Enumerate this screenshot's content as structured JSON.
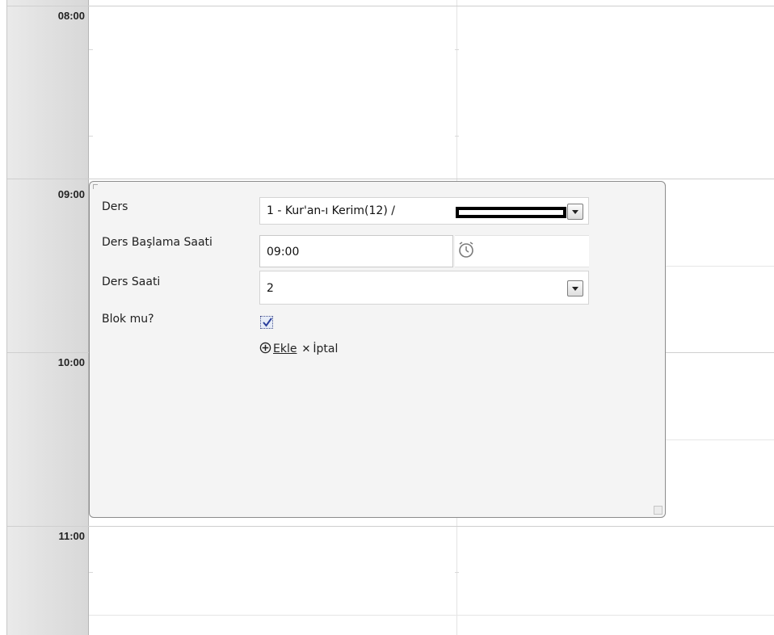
{
  "timeline": {
    "hours": [
      "08:00",
      "09:00",
      "10:00",
      "11:00"
    ]
  },
  "form": {
    "lesson": {
      "label": "Ders",
      "value": "1 - Kur'an-ı Kerim(12) /"
    },
    "start_time": {
      "label": "Ders Başlama Saati",
      "value": "09:00"
    },
    "lesson_hours": {
      "label": "Ders Saati",
      "value": "2"
    },
    "is_block": {
      "label": "Blok mu?",
      "checked": true
    },
    "actions": {
      "add_label": "Ekle",
      "cancel_label": "İptal"
    }
  },
  "icons": {
    "clock": "alarm-clock-icon",
    "add": "plus-circle-icon",
    "cancel": "close-icon"
  }
}
